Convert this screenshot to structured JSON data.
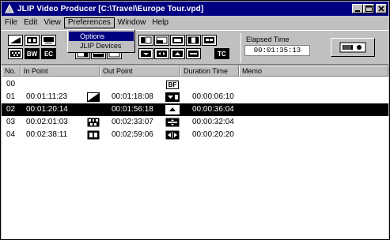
{
  "window": {
    "title": "JLIP Video Producer [C:\\Travel\\Europe Tour.vpd]"
  },
  "menu": {
    "file": "File",
    "edit": "Edit",
    "view": "View",
    "preferences": "Preferences",
    "window": "Window",
    "help": "Help"
  },
  "preferences_menu": {
    "options": "Options",
    "jlip_devices": "JLIP Devices"
  },
  "toolbar": {
    "bw_label": "BW",
    "ec_label": "EC",
    "tc_label": "TC",
    "bf_label": "BF",
    "elapsed_label": "Elapsed Time",
    "elapsed_value": "00:01:35:13"
  },
  "table": {
    "columns": [
      "No.",
      "In Point",
      "Out Point",
      "Duration Time",
      "Memo"
    ],
    "rows": [
      {
        "no": "00",
        "in": "",
        "out": "",
        "effect": "bf-icon",
        "duration": "",
        "memo": "",
        "selected": false
      },
      {
        "no": "01",
        "in": "00:01:11:23",
        "in_effect": "wipe-diagonal-icon",
        "out": "00:01:18:08",
        "effect": "slide-bottom-icon",
        "duration": "00:00:06:10",
        "memo": "",
        "selected": false
      },
      {
        "no": "02",
        "in": "00:01:20:14",
        "in_effect": "",
        "out": "00:01:56:18",
        "effect": "wipe-up-icon",
        "duration": "00:00:36:04",
        "memo": "",
        "selected": true
      },
      {
        "no": "03",
        "in": "00:02:01:03",
        "in_effect": "film-mosaic-icon",
        "out": "00:02:33:07",
        "effect": "wipe-center-icon",
        "duration": "00:00:32:04",
        "memo": "",
        "selected": false
      },
      {
        "no": "04",
        "in": "00:02:38:11",
        "in_effect": "film-strip-icon",
        "out": "00:02:59:06",
        "effect": "slide-open-icon",
        "duration": "00:00:20:20",
        "memo": "",
        "selected": false
      }
    ]
  }
}
